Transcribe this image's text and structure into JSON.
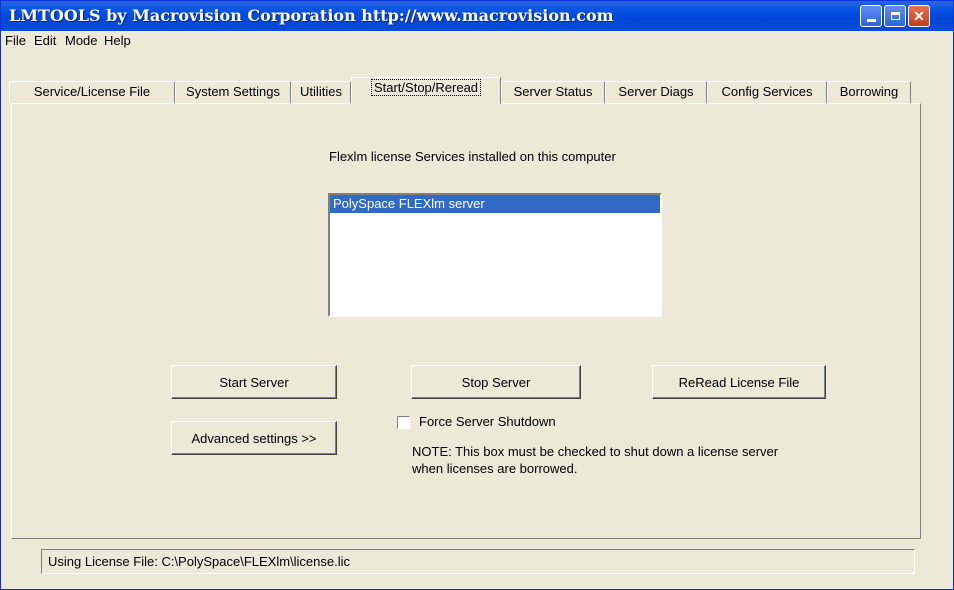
{
  "window": {
    "title": "LMTOOLS by Macrovision Corporation http://www.macrovision.com"
  },
  "menu": {
    "items": [
      "File",
      "Edit",
      "Mode",
      "Help"
    ]
  },
  "tabs": [
    {
      "label": "Service/License File"
    },
    {
      "label": "System Settings"
    },
    {
      "label": "Utilities"
    },
    {
      "label": "Start/Stop/Reread"
    },
    {
      "label": "Server Status"
    },
    {
      "label": "Server Diags"
    },
    {
      "label": "Config Services"
    },
    {
      "label": "Borrowing"
    }
  ],
  "active_tab": "Start/Stop/Reread",
  "panel": {
    "services_heading": "Flexlm license Services installed on this computer",
    "services": [
      {
        "name": "PolySpace FLEXlm server",
        "selected": true
      }
    ],
    "buttons": {
      "start": "Start Server",
      "stop": "Stop Server",
      "reread": "ReRead License File",
      "advanced": "Advanced settings >>"
    },
    "force_shutdown": {
      "label": "Force Server Shutdown",
      "checked": false
    },
    "note_line1": "NOTE:  This box must be checked to shut down a license server",
    "note_line2": "when licenses are borrowed."
  },
  "status": {
    "text": "Using License File:  C:\\PolySpace\\FLEXlm\\license.lic"
  },
  "colors": {
    "titlebar": "#0a56e6",
    "selection": "#316ac5",
    "face": "#ece9d8"
  }
}
